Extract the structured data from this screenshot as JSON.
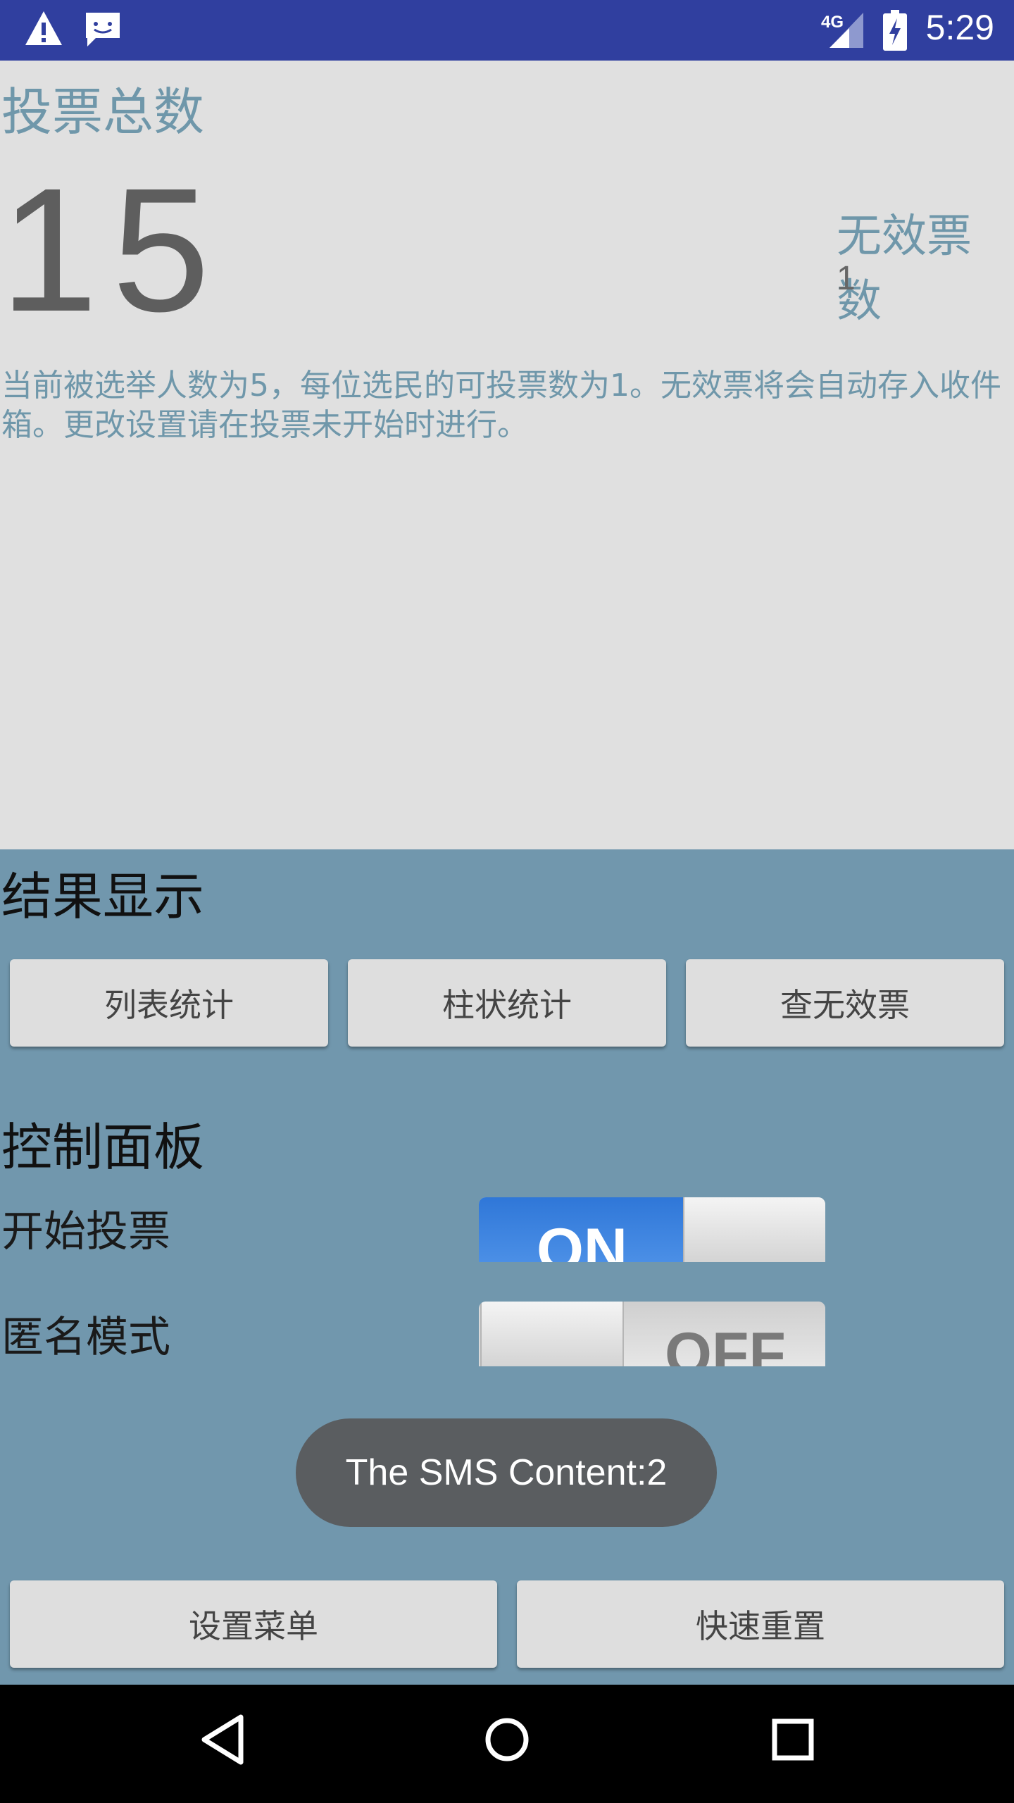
{
  "status_bar": {
    "time": "5:29",
    "network": "4G",
    "icons": [
      "warning-icon",
      "message-icon",
      "signal-icon",
      "battery-charging-icon"
    ]
  },
  "top": {
    "total_label": "投票总数",
    "total_value": "15",
    "invalid_label": "无效票数",
    "invalid_value": "1",
    "info_text": "当前被选举人数为5，每位选民的可投票数为1。无效票将会自动存入收件箱。更改设置请在投票未开始时进行。"
  },
  "results": {
    "title": "结果显示",
    "buttons": [
      "列表统计",
      "柱状统计",
      "查无效票"
    ]
  },
  "control": {
    "title": "控制面板",
    "start_label": "开始投票",
    "start_switch": "ON",
    "anon_label": "匿名模式",
    "anon_switch": "OFF"
  },
  "toast": "The SMS Content:2",
  "bottom_buttons": [
    "设置菜单",
    "快速重置"
  ],
  "colors": {
    "status_bar": "#303f9f",
    "top_bg": "#e0e0e0",
    "bottom_bg": "#7197ad",
    "accent_text": "#6f97aa",
    "switch_on": "#2f77d8"
  }
}
